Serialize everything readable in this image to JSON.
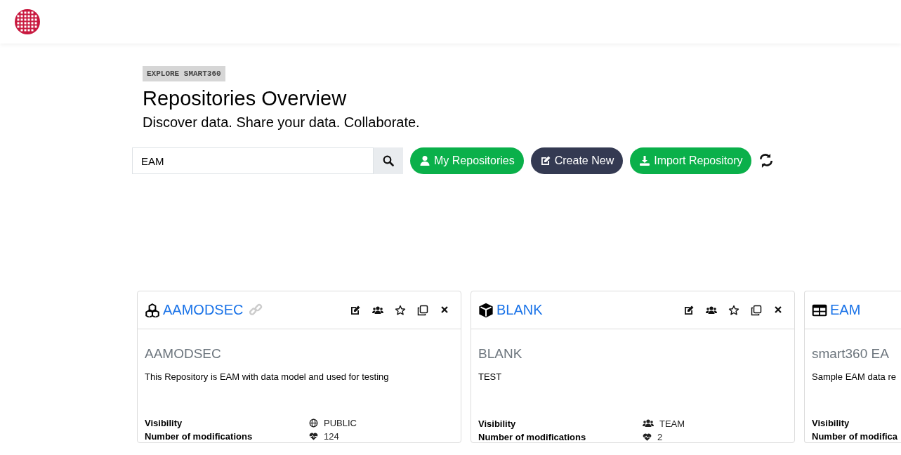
{
  "badge": "EXPLORE SMART360",
  "title": "Repositories Overview",
  "subtitle": "Discover data. Share your data. Collaborate.",
  "search": {
    "value": "EAM"
  },
  "buttons": [
    {
      "label": "My Repositories",
      "kind": "user"
    },
    {
      "label": "Create New",
      "kind": "edit"
    },
    {
      "label": "Import Repository",
      "kind": "download"
    }
  ],
  "cards": [
    {
      "kind": "cubes",
      "title": "AAMODSEC",
      "linked": true,
      "actions": true,
      "name": "AAMODSEC",
      "description": "This Repository is EAM with data model and used for testing",
      "visibility_label": "Visibility",
      "visibility": {
        "kind": "globe",
        "value": "PUBLIC"
      },
      "modifications_label": "Number of modifications",
      "modifications": "124"
    },
    {
      "kind": "cube",
      "title": "BLANK",
      "linked": false,
      "actions": true,
      "name": "BLANK",
      "description": "TEST",
      "visibility_label": "Visibility",
      "visibility": {
        "kind": "team",
        "value": "TEAM"
      },
      "modifications_label": "Number of modifications",
      "modifications": "2"
    },
    {
      "kind": "table",
      "title": "EAM",
      "linked": false,
      "actions": false,
      "name": "smart360 EA",
      "description": "Sample EAM data re",
      "visibility_label": "Visibility",
      "modifications_label": "Number of modifica"
    }
  ]
}
